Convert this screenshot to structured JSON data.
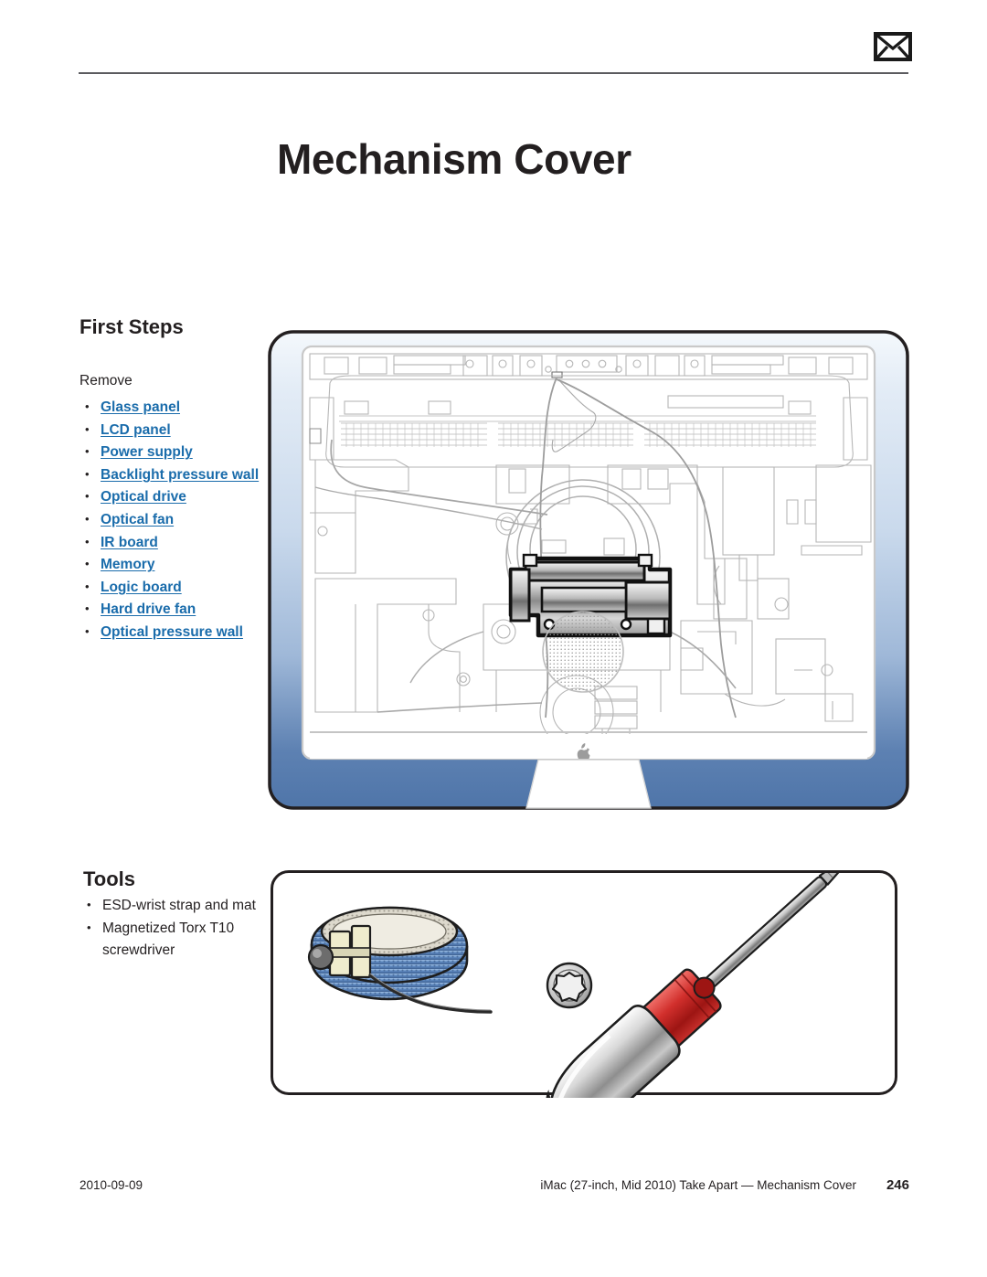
{
  "header": {
    "mail_icon": "envelope-icon"
  },
  "title": "Mechanism Cover",
  "first_steps": {
    "heading": "First Steps",
    "intro": "Remove",
    "items": [
      {
        "label": "Glass panel",
        "link": true
      },
      {
        "label": "LCD panel",
        "link": true
      },
      {
        "label": "Power supply",
        "link": true
      },
      {
        "label": "Backlight pressure wall",
        "link": true
      },
      {
        "label": "Optical drive",
        "link": true
      },
      {
        "label": "Optical fan",
        "link": true
      },
      {
        "label": "IR board",
        "link": true
      },
      {
        "label": "Memory",
        "link": true
      },
      {
        "label": "Logic board",
        "link": true
      },
      {
        "label": "Hard drive fan",
        "link": true
      },
      {
        "label": "Optical pressure wall",
        "link": true
      }
    ]
  },
  "tools": {
    "heading": "Tools",
    "items": [
      {
        "label": "ESD-wrist strap and mat",
        "link": false
      },
      {
        "label": "Magnetized Torx T10 screwdriver",
        "link": false
      }
    ],
    "illustration_parts": [
      "esd-wrist-strap-icon",
      "torx-screw-head-icon",
      "torx-screwdriver-icon"
    ]
  },
  "illustration": {
    "name": "imac-interior-diagram",
    "caption_parts": [
      "mechanism-cover-highlight",
      "apple-logo"
    ],
    "frame_color_top": "#e7eef7",
    "frame_color_bottom": "#5077ab",
    "outline_color": "#231f20"
  },
  "footer": {
    "date": "2010-09-09",
    "document": "iMac (27-inch, Mid 2010) Take Apart — Mechanism Cover",
    "page": "246"
  },
  "colors": {
    "link": "#1a6cab",
    "text": "#231f20",
    "rule": "#5b5b5f"
  }
}
